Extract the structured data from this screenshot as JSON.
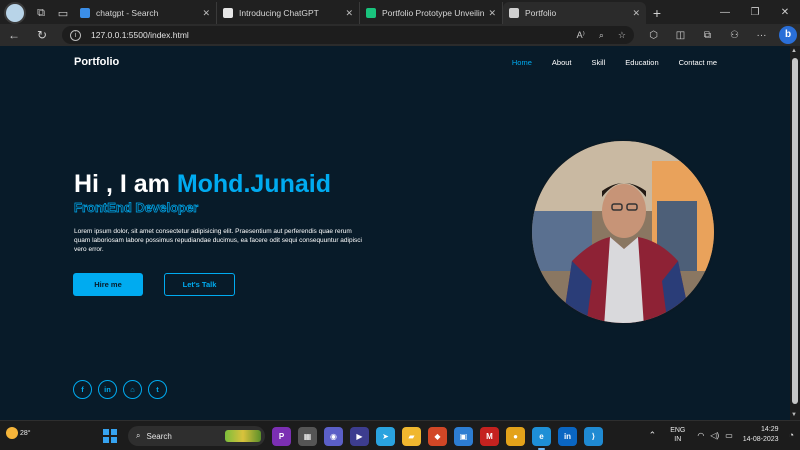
{
  "browser": {
    "tabs": [
      {
        "title": "chatgpt - Search",
        "favicon_color": "#3b8ee8",
        "active": false
      },
      {
        "title": "Introducing ChatGPT",
        "favicon_color": "#e6e6e6",
        "active": false
      },
      {
        "title": "Portfolio Prototype Unveiling 🚀",
        "favicon_color": "#19c37d",
        "active": false
      },
      {
        "title": "Portfolio",
        "favicon_color": "#d0d0d0",
        "active": true
      }
    ],
    "url": "127.0.0.1:5500/index.html"
  },
  "page": {
    "logo": "Portfolio",
    "nav": [
      {
        "label": "Home",
        "active": true
      },
      {
        "label": "About",
        "active": false
      },
      {
        "label": "Skill",
        "active": false
      },
      {
        "label": "Education",
        "active": false
      },
      {
        "label": "Contact me",
        "active": false
      }
    ],
    "greeting": "Hi , I am ",
    "name": "Mohd.Junaid",
    "role": "FrontEnd Developer",
    "paragraph": "Lorem ipsum dolor, sit amet consectetur adipisicing elit. Praesentium aut perferendis quae rerum quam laboriosam labore possimus repudiandae ducimus, ea facere odit sequi consequuntur adipisci vero error.",
    "primary_button": "Hire me",
    "secondary_button": "Let's Talk",
    "socials": [
      {
        "icon": "facebook-icon",
        "glyph": "f"
      },
      {
        "icon": "linkedin-icon",
        "glyph": "in"
      },
      {
        "icon": "github-icon",
        "glyph": "⌂"
      },
      {
        "icon": "twitter-icon",
        "glyph": "t"
      }
    ],
    "accent_color": "#00abf0",
    "background_color": "#081b29"
  },
  "taskbar": {
    "weather_temp": "28°",
    "search_placeholder": "Search",
    "apps": [
      {
        "icon": "widgets-icon",
        "glyph": "P",
        "color": "#7b2fb3",
        "active": false
      },
      {
        "icon": "file-explorer-icon",
        "glyph": "▦",
        "color": "#555555",
        "active": false
      },
      {
        "icon": "meet-icon",
        "glyph": "◉",
        "color": "#5b5fc7",
        "active": false
      },
      {
        "icon": "media-icon",
        "glyph": "▶",
        "color": "#3d3d8f",
        "active": false
      },
      {
        "icon": "telegram-icon",
        "glyph": "➤",
        "color": "#2aa3df",
        "active": false
      },
      {
        "icon": "folder-icon",
        "glyph": "▰",
        "color": "#f0b72f",
        "active": false
      },
      {
        "icon": "office-icon",
        "glyph": "◆",
        "color": "#d24726",
        "active": false
      },
      {
        "icon": "store-icon",
        "glyph": "▣",
        "color": "#2d7dd2",
        "active": false
      },
      {
        "icon": "gmail-icon",
        "glyph": "M",
        "color": "#c5221f",
        "active": false
      },
      {
        "icon": "chrome-icon",
        "glyph": "●",
        "color": "#e3a21a",
        "active": false
      },
      {
        "icon": "edge-icon",
        "glyph": "e",
        "color": "#1e8fd6",
        "active": true
      },
      {
        "icon": "linkedin-app-icon",
        "glyph": "in",
        "color": "#0a66c2",
        "active": false
      },
      {
        "icon": "vscode-icon",
        "glyph": "⟩",
        "color": "#1f8ad2",
        "active": false
      }
    ],
    "lang_line1": "ENG",
    "lang_line2": "IN",
    "time": "14:29",
    "date": "14-08-2023"
  }
}
